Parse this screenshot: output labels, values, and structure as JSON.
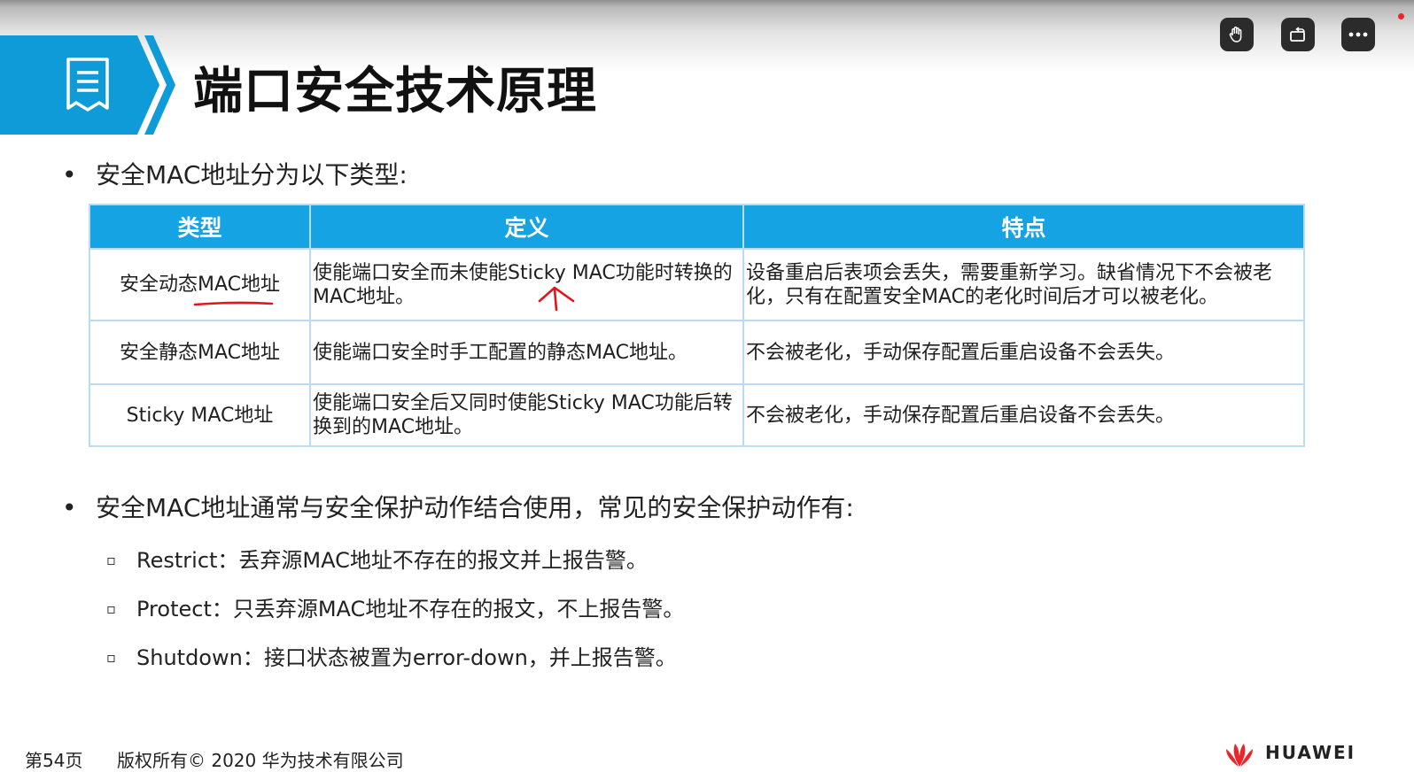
{
  "slide": {
    "title": "端口安全技术原理",
    "bullet1": "安全MAC地址分为以下类型:",
    "table": {
      "headers": [
        "类型",
        "定义",
        "特点"
      ],
      "rows": [
        {
          "type": "安全动态MAC地址",
          "definition": "使能端口安全而未使能Sticky MAC功能时转换的MAC地址。",
          "feature": "设备重启后表项会丢失，需要重新学习。缺省情况下不会被老化，只有在配置安全MAC的老化时间后才可以被老化。"
        },
        {
          "type": "安全静态MAC地址",
          "definition": "使能端口安全时手工配置的静态MAC地址。",
          "feature": "不会被老化，手动保存配置后重启设备不会丢失。"
        },
        {
          "type": "Sticky MAC地址",
          "definition": "使能端口安全后又同时使能Sticky MAC功能后转换到的MAC地址。",
          "feature": "不会被老化，手动保存配置后重启设备不会丢失。"
        }
      ]
    },
    "bullet2": "安全MAC地址通常与安全保护动作结合使用，常见的安全保护动作有:",
    "actions": [
      "Restrict：丢弃源MAC地址不存在的报文并上报告警。",
      "Protect：只丢弃源MAC地址不存在的报文，不上报告警。",
      "Shutdown：接口状态被置为error-down，并上报告警。"
    ],
    "footer": {
      "page": "第54页",
      "copyright": "版权所有© 2020 华为技术有限公司",
      "logo_text": "HUAWEI"
    }
  },
  "controls": {
    "icons": [
      "hand-raise-icon",
      "screen-rotate-icon",
      "more-icon"
    ]
  },
  "colors": {
    "banner_blue": "#0f9ad8",
    "header_blue": "#16a3e4",
    "grid_line": "#b9dcf2",
    "annotation_red": "#e0161c",
    "logo_red": "#e8262b"
  }
}
